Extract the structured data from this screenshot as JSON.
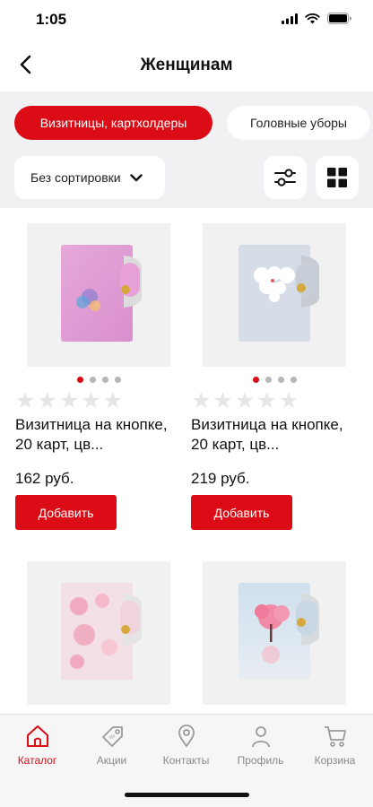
{
  "status_bar": {
    "time": "1:05"
  },
  "nav": {
    "title": "Женщинам"
  },
  "categories": [
    {
      "label": "Визитницы, картхолдеры",
      "active": true
    },
    {
      "label": "Головные уборы",
      "active": false
    }
  ],
  "sort": {
    "label": "Без сортировки"
  },
  "products": [
    {
      "title": "Визитница на кнопке, 20 карт, цв...",
      "price": "162 руб.",
      "add_label": "Добавить",
      "images_count": 4,
      "active_image": 1,
      "rating": 0
    },
    {
      "title": "Визитница на кнопке, 20 карт, цв...",
      "price": "219 руб.",
      "add_label": "Добавить",
      "images_count": 4,
      "active_image": 1,
      "rating": 0
    }
  ],
  "tabs": [
    {
      "label": "Каталог",
      "icon": "home-icon",
      "active": true
    },
    {
      "label": "Акции",
      "icon": "tag-icon",
      "active": false
    },
    {
      "label": "Контакты",
      "icon": "location-pin-icon",
      "active": false
    },
    {
      "label": "Профиль",
      "icon": "person-icon",
      "active": false
    },
    {
      "label": "Корзина",
      "icon": "cart-icon",
      "active": false
    }
  ],
  "colors": {
    "accent": "#dc0c16",
    "filter_background": "#f1f1f4",
    "inactive_tab": "#8a8a8a"
  }
}
